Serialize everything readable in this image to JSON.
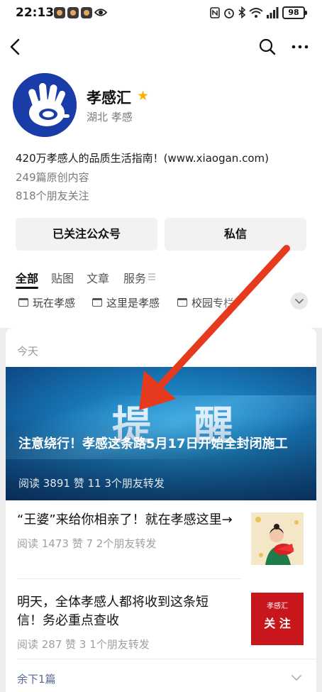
{
  "status_bar": {
    "time": "22:13",
    "battery": "98"
  },
  "nav": {
    "back_icon": "chevron-left-icon",
    "search_icon": "search-icon",
    "more_icon": "more-horizontal-icon"
  },
  "profile": {
    "name": "孝感汇",
    "verified_icon": "star-icon",
    "location": "湖北 孝感",
    "description": "420万孝感人的品质生活指南！(www.xiaogan.com)",
    "original_count": "249篇原创内容",
    "friends_following": "818个朋友关注"
  },
  "actions": {
    "follow_label": "已关注公众号",
    "message_label": "私信"
  },
  "tabs": [
    {
      "label": "全部",
      "active": true
    },
    {
      "label": "贴图"
    },
    {
      "label": "文章"
    },
    {
      "label": "服务"
    }
  ],
  "chips": [
    {
      "label": "玩在孝感"
    },
    {
      "label": "这里是孝感"
    },
    {
      "label": "校园专栏"
    }
  ],
  "feed": {
    "day_label": "今天",
    "hero": {
      "image_text": "提 醒",
      "title": "注意绕行！孝感这条路5月17日开始全封闭施工",
      "meta": "阅读 3891   赞 11   3个朋友转发"
    },
    "articles": [
      {
        "title": "“王婆”来给你相亲了！就在孝感这里→",
        "meta": "阅读 1473   赞 7   2个朋友转发"
      },
      {
        "title": "明天，全体孝感人都将收到这条短信！务必重点查收",
        "meta": "阅读 287   赞 3   1个朋友转发",
        "thumb_small": "孝感汇",
        "thumb_big": "关 注"
      }
    ],
    "remaining": "余下1篇"
  },
  "colors": {
    "accent_link": "#576b95",
    "star": "#f5b400",
    "annotation_arrow": "#e53a1e",
    "logo_blue": "#1a3ca8"
  }
}
